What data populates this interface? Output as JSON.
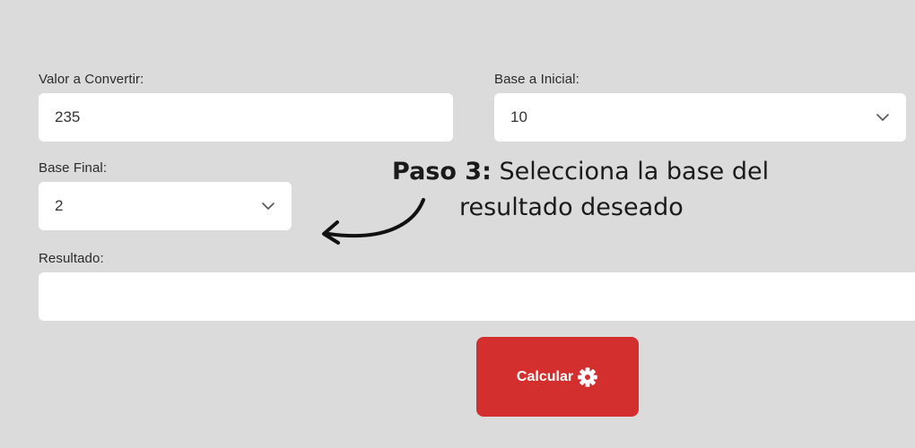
{
  "form": {
    "valor_label": "Valor a Convertir:",
    "valor_value": "235",
    "base_inicial_label": "Base a Inicial:",
    "base_inicial_value": "10",
    "base_final_label": "Base Final:",
    "base_final_value": "2",
    "resultado_label": "Resultado:",
    "resultado_value": ""
  },
  "annotation": {
    "step": "Paso 3:",
    "line1": " Selecciona la base del",
    "line2": "resultado deseado"
  },
  "button": {
    "label": "Calcular",
    "icon": "gear-icon",
    "color": "#d32f2f"
  }
}
